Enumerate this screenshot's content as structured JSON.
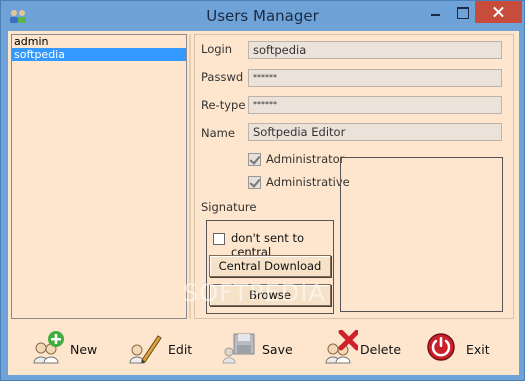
{
  "window": {
    "title": "Users Manager"
  },
  "users": [
    {
      "name": "admin",
      "selected": false
    },
    {
      "name": "softpedia",
      "selected": true
    }
  ],
  "form": {
    "login_label": "Login",
    "login_value": "softpedia",
    "passwd_label": "Passwd",
    "passwd_value": "******",
    "retype_label": "Re-type",
    "retype_value": "******",
    "name_label": "Name",
    "name_value": "Softpedia Editor",
    "administrator_label": "Administrator",
    "administrator_checked": true,
    "administrative_label": "Administrative",
    "administrative_checked": true,
    "signature_label": "Signature",
    "dont_sent_label": "don't sent to central",
    "dont_sent_checked": false,
    "central_download_label": "Central Download",
    "browse_label": "Browse"
  },
  "toolbar": {
    "new_label": "New",
    "edit_label": "Edit",
    "save_label": "Save",
    "delete_label": "Delete",
    "exit_label": "Exit"
  },
  "watermark": "SOFTPEDIA",
  "colors": {
    "client_bg": "#fde6cd",
    "titlebar": "#6fa3d8",
    "selection": "#3399ff",
    "close_button": "#c74c3c"
  }
}
